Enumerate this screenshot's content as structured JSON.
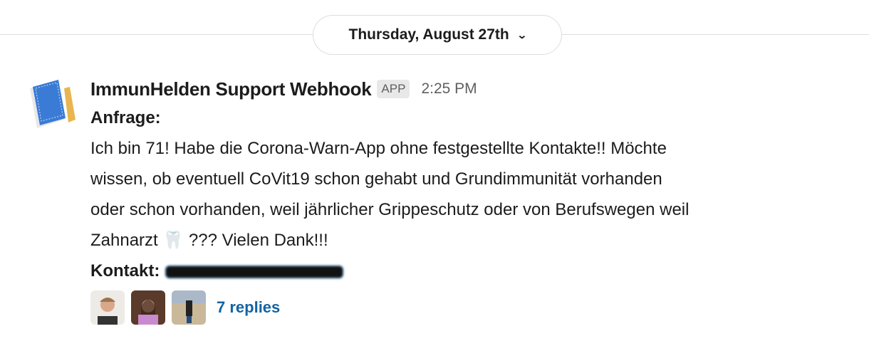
{
  "date_divider": {
    "label": "Thursday, August 27th",
    "icon": "chevron-down-icon"
  },
  "message": {
    "sender": "ImmunHelden Support Webhook",
    "badge": "APP",
    "time": "2:25 PM",
    "request_label": "Anfrage:",
    "body_lines": [
      "Ich bin 71! Habe die Corona-Warn-App ohne festgestellte Kontakte!! Möchte",
      "wissen, ob eventuell CoVit19 schon gehabt und Grundimmunität vorhanden",
      "oder schon vorhanden, weil jährlicher Grippeschutz oder von Berufswegen weil",
      "Zahnarzt 🦷 ??? Vielen Dank!!!"
    ],
    "contact_label": "Kontakt:",
    "replies": {
      "label": "7 replies",
      "link_color": "#1264a3"
    }
  }
}
